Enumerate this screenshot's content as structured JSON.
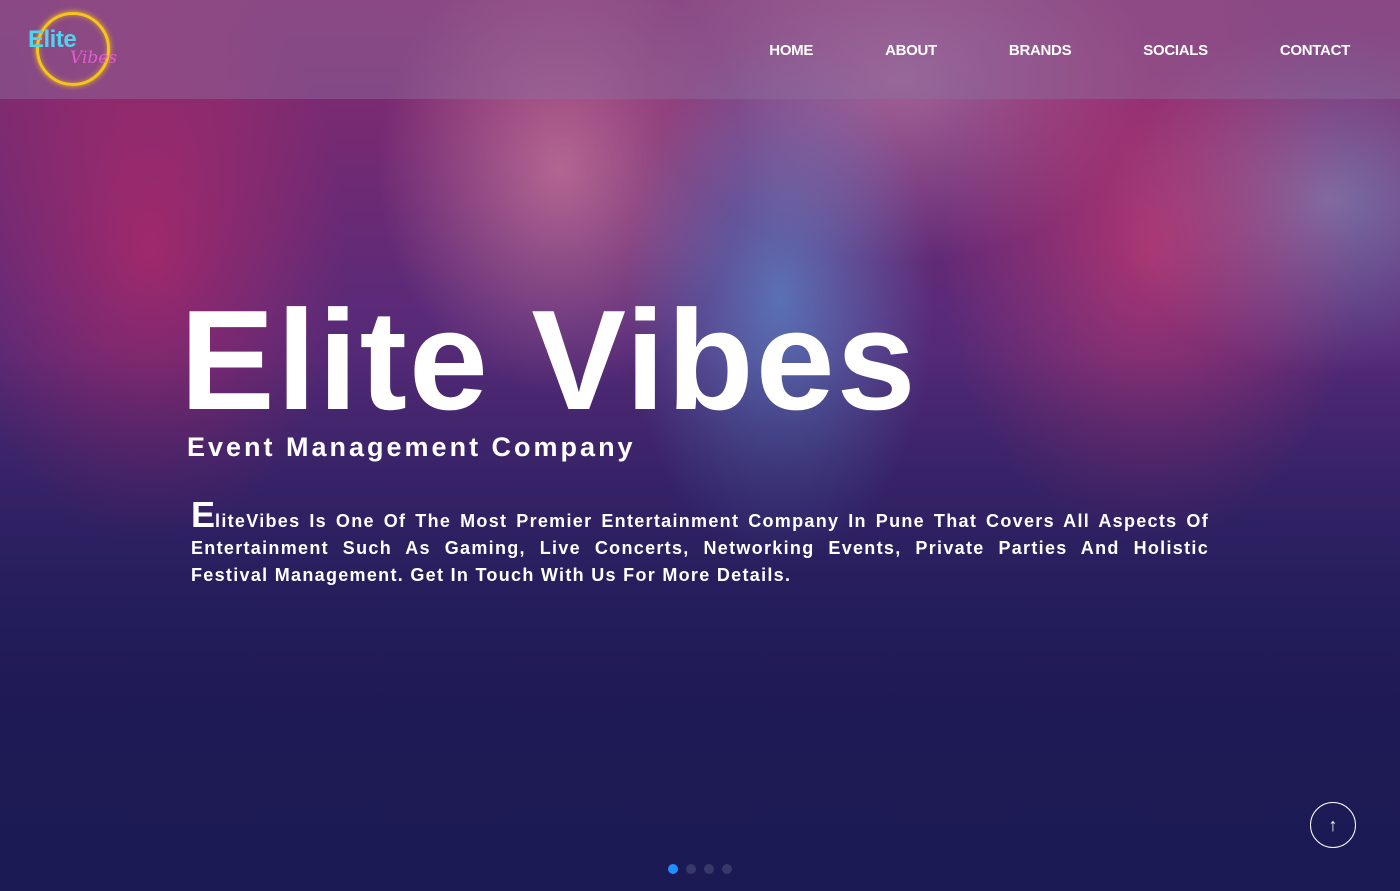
{
  "logo": {
    "line1": "Elite",
    "line2": "Vibes"
  },
  "nav": {
    "items": [
      "HOME",
      "ABOUT",
      "BRANDS",
      "SOCIALS",
      "CONTACT"
    ]
  },
  "hero": {
    "title": "Elite Vibes",
    "subtitle": "Event Management Company",
    "description_initial": "E",
    "description_rest": "liteVibes Is One Of The Most Premier Entertainment Company In Pune That Covers All Aspects Of Entertainment Such As Gaming, Live Concerts, Networking Events, Private Parties And Holistic Festival Management. Get In Touch With Us For More Details."
  },
  "back_to_top": {
    "icon": "arrow-up-icon",
    "glyph": "↑"
  },
  "carousel": {
    "slide_count": 4,
    "active_index": 0
  },
  "colors": {
    "accent_cyan": "#4fd4ec",
    "accent_pink": "#e25ccc",
    "ring_yellow": "#f5c518",
    "dot_active": "#1e8fff"
  }
}
